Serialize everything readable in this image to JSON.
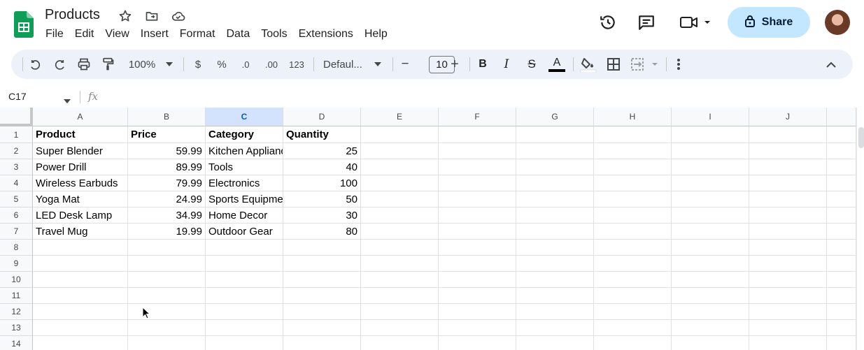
{
  "doc": {
    "title": "Products"
  },
  "menu": [
    "File",
    "Edit",
    "View",
    "Insert",
    "Format",
    "Data",
    "Tools",
    "Extensions",
    "Help"
  ],
  "share": {
    "label": "Share"
  },
  "toolbar": {
    "zoom": "100%",
    "currency": "$",
    "percent": "%",
    "decrease_decimal": ".0",
    "increase_decimal": ".00",
    "number_format": "123",
    "font": "Defaul...",
    "font_size": "10",
    "minus": "−",
    "plus": "+",
    "bold": "B",
    "italic": "I",
    "strike": "S",
    "text_color": "A"
  },
  "formula_bar": {
    "cell_ref": "C17",
    "fx": "fx"
  },
  "columns": [
    "A",
    "B",
    "C",
    "D",
    "E",
    "F",
    "G",
    "H",
    "I",
    "J"
  ],
  "selected_column": "C",
  "rows": [
    "1",
    "2",
    "3",
    "4",
    "5",
    "6",
    "7",
    "8",
    "9",
    "10",
    "11",
    "12",
    "13",
    "14"
  ],
  "table": {
    "headers": [
      "Product",
      "Price",
      "Category",
      "Quantity"
    ],
    "rows": [
      [
        "Super Blender",
        "59.99",
        "Kitchen Appliances",
        "25"
      ],
      [
        "Power Drill",
        "89.99",
        "Tools",
        "40"
      ],
      [
        "Wireless Earbuds",
        "79.99",
        "Electronics",
        "100"
      ],
      [
        "Yoga Mat",
        "24.99",
        "Sports Equipment",
        "50"
      ],
      [
        "LED Desk Lamp",
        "34.99",
        "Home Decor",
        "30"
      ],
      [
        "Travel Mug",
        "19.99",
        "Outdoor Gear",
        "80"
      ]
    ]
  },
  "colors": {
    "accent": "#0b57d0",
    "share_bg": "#c2e7ff",
    "toolbar_bg": "#edf2fa",
    "sheets_green": "#0f9d58"
  }
}
